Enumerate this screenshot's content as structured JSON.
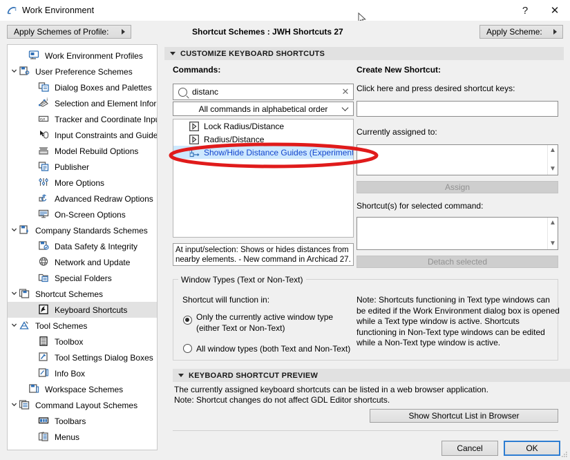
{
  "window": {
    "title": "Work Environment",
    "app_icon": "archicad-icon",
    "help_label": "?",
    "close_label": "✕"
  },
  "toolbar": {
    "apply_profile_label": "Apply Schemes of Profile:",
    "apply_scheme_label": "Apply Scheme:",
    "scheme_status": "Shortcut Schemes :  JWH Shortcuts 27"
  },
  "sidebar": {
    "items": [
      {
        "label": "Work Environment Profiles",
        "icon": "work-environment-profiles-icon",
        "indent": 1,
        "chev": "",
        "selected": false
      },
      {
        "label": "User Preference Schemes",
        "icon": "user-preference-schemes-icon",
        "indent": 0,
        "chev": "⌄",
        "selected": false
      },
      {
        "label": "Dialog Boxes and Palettes",
        "icon": "dialog-boxes-icon",
        "indent": 2,
        "chev": "",
        "selected": false
      },
      {
        "label": "Selection and Element Information",
        "icon": "selection-info-icon",
        "indent": 2,
        "chev": "",
        "selected": false
      },
      {
        "label": "Tracker and Coordinate Input",
        "icon": "tracker-coordinate-icon",
        "indent": 2,
        "chev": "",
        "selected": false
      },
      {
        "label": "Input Constraints and Guides",
        "icon": "input-constraints-icon",
        "indent": 2,
        "chev": "",
        "selected": false
      },
      {
        "label": "Model Rebuild Options",
        "icon": "model-rebuild-icon",
        "indent": 2,
        "chev": "",
        "selected": false
      },
      {
        "label": "Publisher",
        "icon": "publisher-icon",
        "indent": 2,
        "chev": "",
        "selected": false
      },
      {
        "label": "More Options",
        "icon": "more-options-icon",
        "indent": 2,
        "chev": "",
        "selected": false
      },
      {
        "label": "Advanced Redraw Options",
        "icon": "advanced-redraw-icon",
        "indent": 2,
        "chev": "",
        "selected": false
      },
      {
        "label": "On-Screen Options",
        "icon": "on-screen-options-icon",
        "indent": 2,
        "chev": "",
        "selected": false
      },
      {
        "label": "Company Standards Schemes",
        "icon": "company-standards-icon",
        "indent": 0,
        "chev": "⌄",
        "selected": false
      },
      {
        "label": "Data Safety & Integrity",
        "icon": "data-safety-icon",
        "indent": 2,
        "chev": "",
        "selected": false
      },
      {
        "label": "Network and Update",
        "icon": "network-update-icon",
        "indent": 2,
        "chev": "",
        "selected": false
      },
      {
        "label": "Special Folders",
        "icon": "special-folders-icon",
        "indent": 2,
        "chev": "",
        "selected": false
      },
      {
        "label": "Shortcut Schemes",
        "icon": "shortcut-schemes-icon",
        "indent": 0,
        "chev": "⌄",
        "selected": false
      },
      {
        "label": "Keyboard Shortcuts",
        "icon": "keyboard-shortcuts-icon",
        "indent": 2,
        "chev": "",
        "selected": true
      },
      {
        "label": "Tool Schemes",
        "icon": "tool-schemes-icon",
        "indent": 0,
        "chev": "⌄",
        "selected": false
      },
      {
        "label": "Toolbox",
        "icon": "toolbox-icon",
        "indent": 2,
        "chev": "",
        "selected": false
      },
      {
        "label": "Tool Settings Dialog Boxes",
        "icon": "tool-settings-icon",
        "indent": 2,
        "chev": "",
        "selected": false
      },
      {
        "label": "Info Box",
        "icon": "info-box-icon",
        "indent": 2,
        "chev": "",
        "selected": false
      },
      {
        "label": "Workspace Schemes",
        "icon": "workspace-schemes-icon",
        "indent": 1,
        "chev": "",
        "selected": false
      },
      {
        "label": "Command Layout Schemes",
        "icon": "command-layout-icon",
        "indent": 0,
        "chev": "⌄",
        "selected": false
      },
      {
        "label": "Toolbars",
        "icon": "toolbars-icon",
        "indent": 2,
        "chev": "",
        "selected": false
      },
      {
        "label": "Menus",
        "icon": "menus-icon",
        "indent": 2,
        "chev": "",
        "selected": false
      }
    ]
  },
  "customize": {
    "section_title": "CUSTOMIZE KEYBOARD SHORTCUTS",
    "commands_label": "Commands:",
    "search_value": "distanc",
    "search_placeholder": "",
    "search_clear_label": "✕",
    "filter_selected": "All commands in alphabetical order",
    "filter_options": [
      "All commands in alphabetical order"
    ],
    "command_list": [
      {
        "label": "Lock Radius/Distance",
        "icon": "play-command-icon",
        "selected": false
      },
      {
        "label": "Radius/Distance",
        "icon": "play-command-icon",
        "selected": false
      },
      {
        "label": "Show/Hide Distance Guides (Experimental)",
        "icon": "distance-guides-icon",
        "selected": true
      }
    ],
    "description": "At input/selection: Shows or hides distances from nearby elements. - New command in Archicad 27."
  },
  "create_shortcut": {
    "title": "Create New Shortcut:",
    "press_keys_label": "Click here and press desired shortcut keys:",
    "shortcut_input_value": "",
    "currently_assigned_label": "Currently assigned to:",
    "currently_assigned_value": "",
    "assign_button": "Assign",
    "shortcuts_for_command_label": "Shortcut(s) for selected command:",
    "shortcuts_for_command_value": "",
    "detach_button": "Detach selected"
  },
  "window_types": {
    "group_title": "Window Types (Text or Non-Text)",
    "function_in_label": "Shortcut will function in:",
    "option_active": "Only the currently active window type (either Text or Non-Text)",
    "option_all": "All window types (both Text and Non-Text)",
    "selected_option": "active",
    "note": "Note: Shortcuts functioning in Text type windows can be edited if the Work Environment dialog box is opened while a Text type window is active. Shortcuts functioning in Non-Text type windows can be edited while a Non-Text type window is active."
  },
  "preview": {
    "section_title": "KEYBOARD SHORTCUT PREVIEW",
    "line1": "The currently assigned keyboard shortcuts can be listed in a web browser application.",
    "line2": "Note: Shortcut changes do not affect GDL Editor shortcuts.",
    "browser_button": "Show Shortcut List in Browser"
  },
  "footer": {
    "cancel_label": "Cancel",
    "ok_label": "OK"
  },
  "annotation": {
    "type": "red-ellipse-highlight",
    "color": "#e01b1b",
    "target": "Show/Hide Distance Guides (Experimental)"
  },
  "colors": {
    "selection_blue": "#cde8ff",
    "link_text": "#1144cc",
    "window_bg": "#f0f0f0",
    "accent": "#2d7dd2"
  }
}
